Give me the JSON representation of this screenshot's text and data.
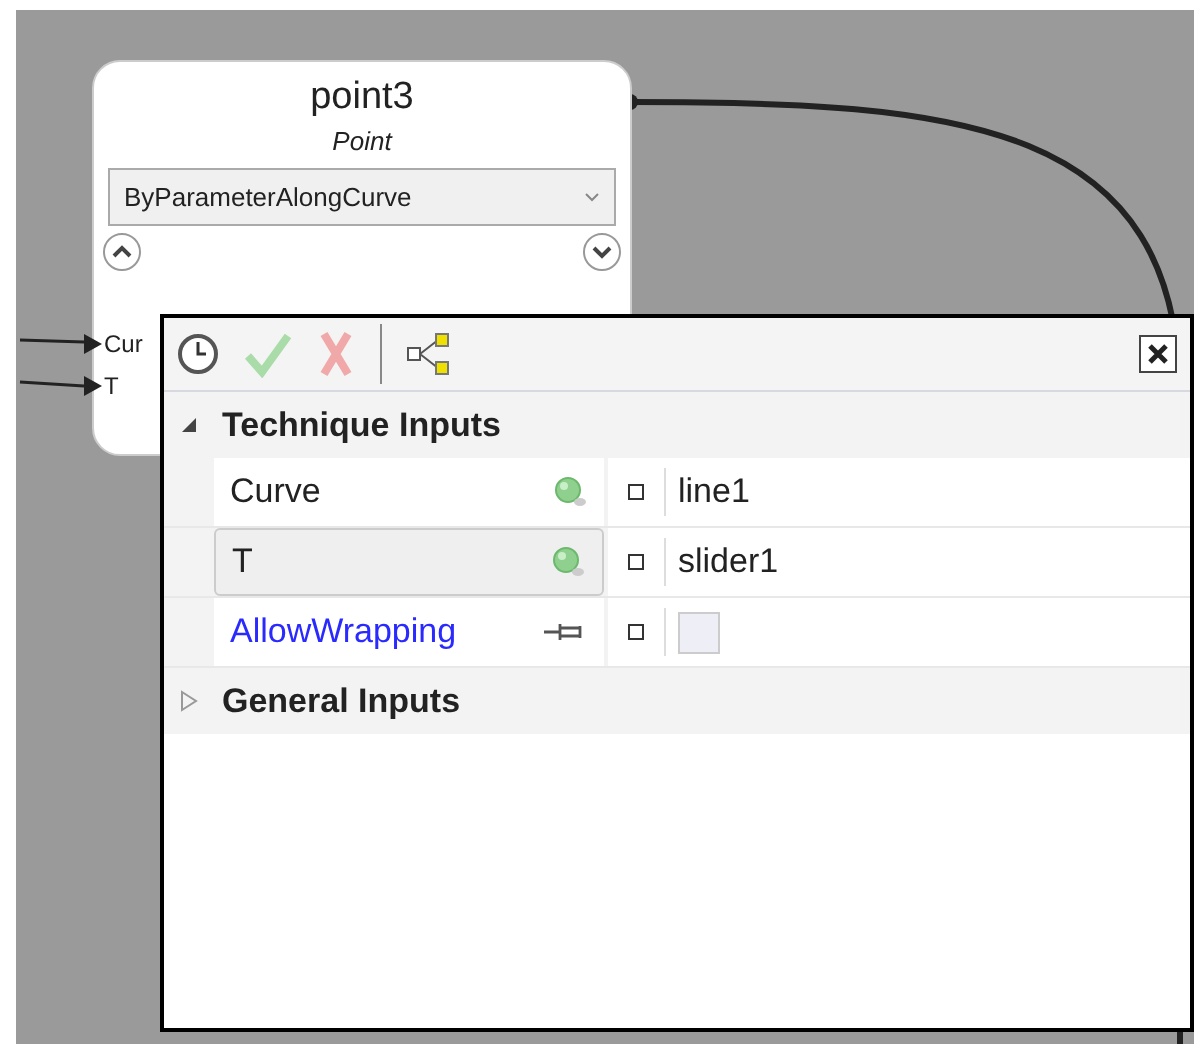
{
  "node": {
    "title": "point3",
    "type": "Point",
    "technique": "ByParameterAlongCurve",
    "ports": [
      {
        "label": "Cur"
      },
      {
        "label": "T"
      }
    ]
  },
  "panel": {
    "sections": [
      {
        "title": "Technique Inputs",
        "expanded": true,
        "rows": [
          {
            "name": "Curve",
            "kind": "connector",
            "selected": false,
            "value": "line1"
          },
          {
            "name": "T",
            "kind": "connector",
            "selected": true,
            "value": "slider1"
          },
          {
            "name": "AllowWrapping",
            "kind": "pin",
            "selected": false,
            "checked": false
          }
        ]
      },
      {
        "title": "General Inputs",
        "expanded": false
      }
    ]
  }
}
